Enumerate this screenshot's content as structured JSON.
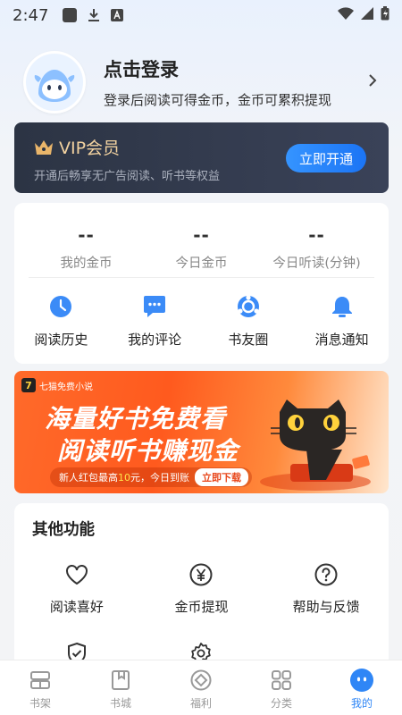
{
  "status_bar": {
    "time": "2:47"
  },
  "profile": {
    "title": "点击登录",
    "subtitle": "登录后阅读可得金币，金币可累积提现"
  },
  "vip": {
    "title": "VIP会员",
    "subtitle": "开通后畅享无广告阅读、听书等权益",
    "button": "立即开通",
    "title_color": "#f2d2a0"
  },
  "stats": [
    {
      "value": "--",
      "label": "我的金币"
    },
    {
      "value": "--",
      "label": "今日金币"
    },
    {
      "value": "--",
      "label": "今日听读(分钟)"
    }
  ],
  "shortcuts": [
    {
      "label": "阅读历史",
      "icon": "clock-icon"
    },
    {
      "label": "我的评论",
      "icon": "comment-icon"
    },
    {
      "label": "书友圈",
      "icon": "circle-icon"
    },
    {
      "label": "消息通知",
      "icon": "bell-icon"
    }
  ],
  "banner": {
    "brand": "七猫免费小说",
    "line1": "海量好书免费看",
    "line2": "阅读听书赚现金",
    "promo_prefix": "新人红包最高",
    "promo_amount": "10",
    "promo_suffix": "元，今日到账",
    "cta": "立即下载"
  },
  "other": {
    "title": "其他功能",
    "items": [
      {
        "label": "阅读喜好",
        "icon": "heart-icon"
      },
      {
        "label": "金币提现",
        "icon": "yen-icon"
      },
      {
        "label": "帮助与反馈",
        "icon": "help-icon"
      },
      {
        "label": "",
        "icon": "shield-check-icon"
      },
      {
        "label": "",
        "icon": "settings-icon"
      }
    ]
  },
  "tabbar": {
    "active": "我的",
    "items": [
      {
        "label": "书架",
        "icon": "bookshelf-icon"
      },
      {
        "label": "书城",
        "icon": "bookstore-icon"
      },
      {
        "label": "福利",
        "icon": "welfare-icon"
      },
      {
        "label": "分类",
        "icon": "category-icon"
      },
      {
        "label": "我的",
        "icon": "profile-icon"
      }
    ]
  },
  "colors": {
    "accent": "#2f86f6",
    "vip_bg": "#2c3444",
    "banner": "#ff5a1e"
  }
}
